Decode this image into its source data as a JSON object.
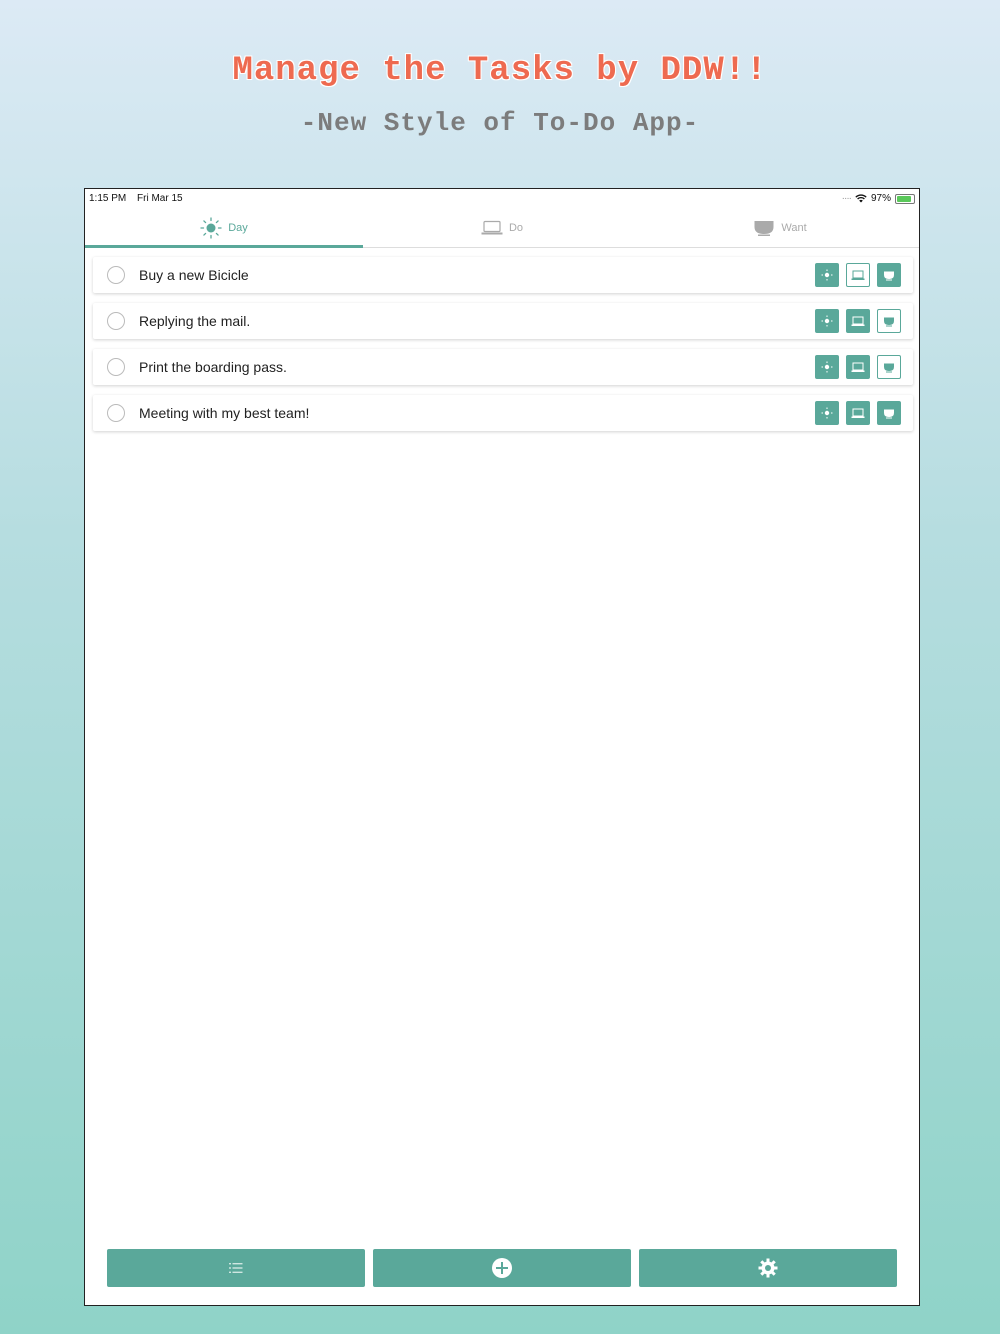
{
  "promo": {
    "title": "Manage the Tasks by DDW!!",
    "subtitle": "-New Style of To-Do App-"
  },
  "status_bar": {
    "time": "1:15 PM",
    "date": "Fri Mar 15",
    "battery": "97%",
    "icons": [
      "cellular-dots-icon",
      "wifi-icon",
      "battery-icon"
    ]
  },
  "tabs": [
    {
      "label": "Day",
      "icon": "sun-icon",
      "active": true
    },
    {
      "label": "Do",
      "icon": "laptop-icon",
      "active": false
    },
    {
      "label": "Want",
      "icon": "cup-icon",
      "active": false
    }
  ],
  "tasks": [
    {
      "text": "Buy a new Bicicle",
      "day": true,
      "do": false,
      "want": true
    },
    {
      "text": "Replying the mail.",
      "day": true,
      "do": true,
      "want": false
    },
    {
      "text": "Print the boarding pass.",
      "day": true,
      "do": true,
      "want": false
    },
    {
      "text": "Meeting with my best team!",
      "day": true,
      "do": true,
      "want": true
    }
  ],
  "bottom_bar": {
    "icons": [
      "list-icon",
      "add-icon",
      "gear-icon"
    ]
  },
  "colors": {
    "accent": "#5aa89a",
    "headline": "#ee6a50",
    "subheadline": "#7c7c7c"
  }
}
